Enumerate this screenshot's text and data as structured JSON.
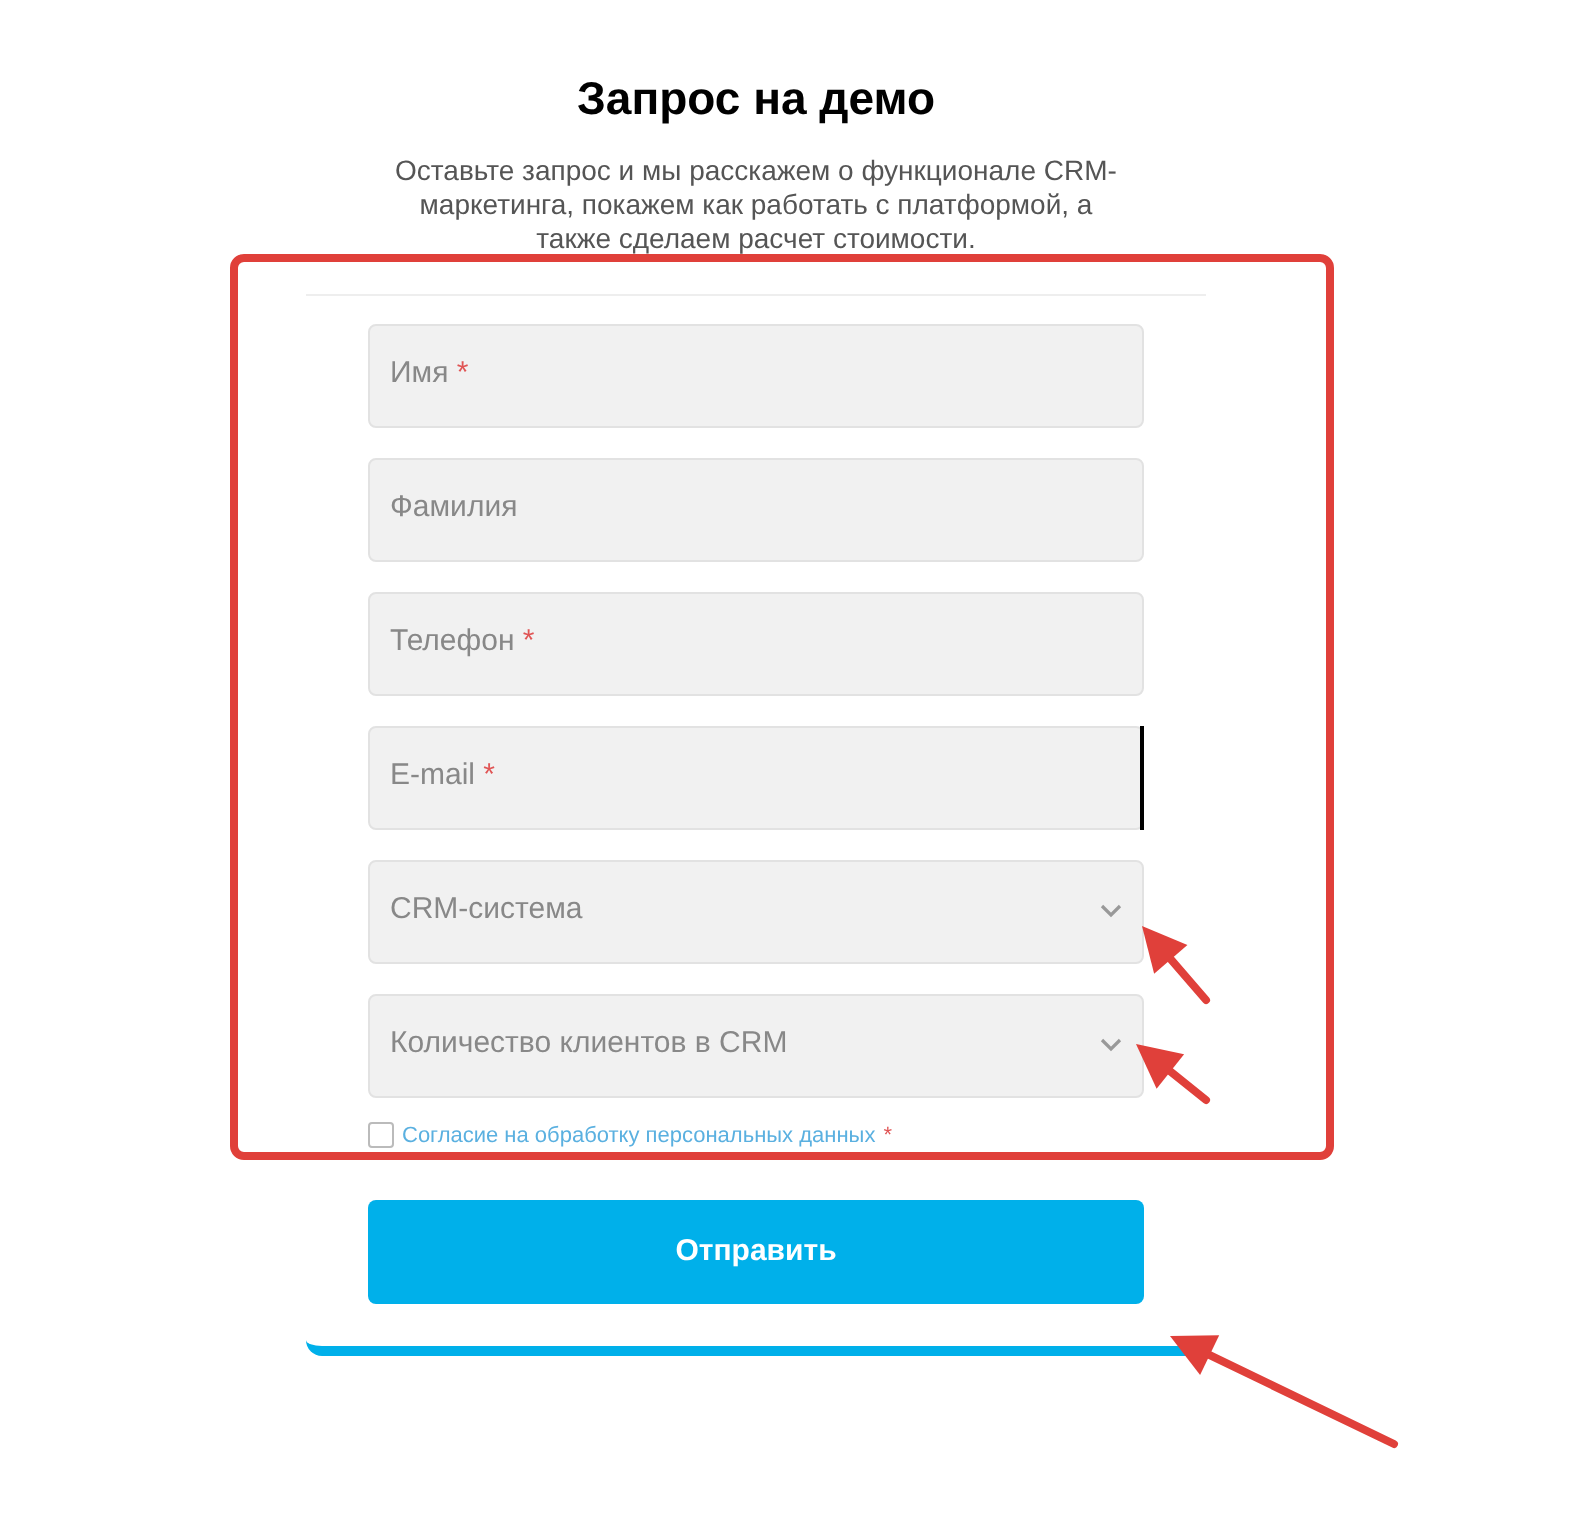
{
  "title": "Запрос на демо",
  "subtitle": "Оставьте запрос и мы расскажем о функционале CRM-маркетинга, покажем как работать с платформой, а также сделаем расчет стоимости.",
  "fields": [
    {
      "kind": "text",
      "placeholder": "Имя",
      "required_mark": "*",
      "focused": false
    },
    {
      "kind": "text",
      "placeholder": "Фамилия",
      "focused": false
    },
    {
      "kind": "text",
      "placeholder": "Телефон",
      "required_mark": "*",
      "focused": false
    },
    {
      "kind": "text",
      "placeholder": "E-mail",
      "required_mark": "*",
      "focused": true
    },
    {
      "kind": "select",
      "placeholder": "CRM-система",
      "focused": false
    },
    {
      "kind": "select",
      "placeholder": "Количество клиентов в CRM",
      "focused": false
    }
  ],
  "consent": {
    "label": "Согласие на обработку персональных данных",
    "required_mark": "*",
    "checked": false
  },
  "submit": "Отправить",
  "annotations": [
    {
      "kind": "frame"
    },
    {
      "kind": "arrow"
    },
    {
      "kind": "arrow"
    },
    {
      "kind": "arrow"
    }
  ]
}
